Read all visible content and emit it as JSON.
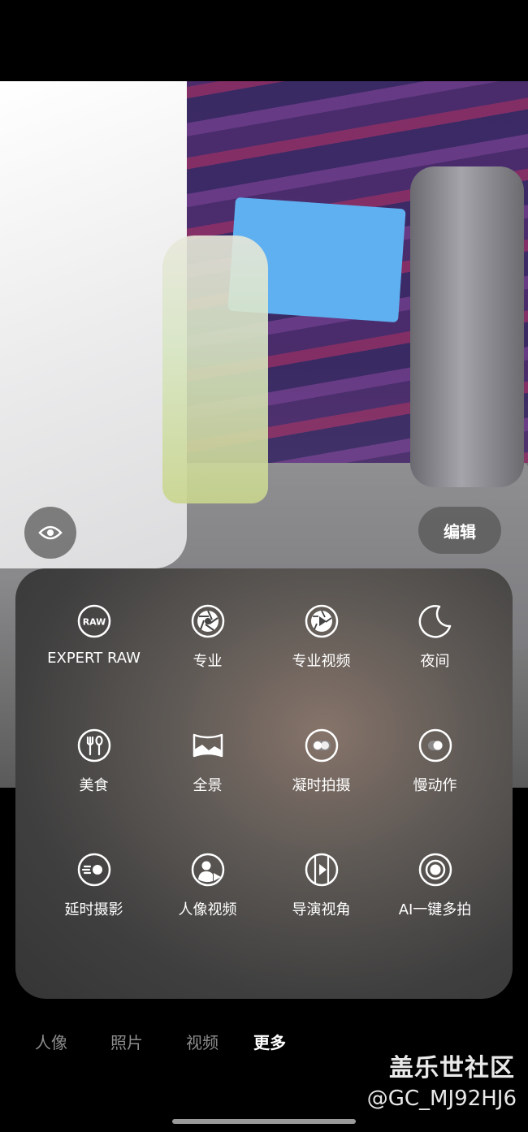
{
  "viewfinder": {
    "edit_label": "编辑"
  },
  "modes": [
    {
      "label": "EXPERT RAW",
      "icon": "raw-icon",
      "icon_text": "RAW"
    },
    {
      "label": "专业",
      "icon": "aperture-icon"
    },
    {
      "label": "专业视频",
      "icon": "pro-video-icon"
    },
    {
      "label": "夜间",
      "icon": "moon-icon"
    },
    {
      "label": "美食",
      "icon": "food-icon"
    },
    {
      "label": "全景",
      "icon": "panorama-icon"
    },
    {
      "label": "凝时拍摄",
      "icon": "hyperlapse-icon"
    },
    {
      "label": "慢动作",
      "icon": "slow-motion-icon"
    },
    {
      "label": "延时摄影",
      "icon": "timelapse-icon"
    },
    {
      "label": "人像视频",
      "icon": "portrait-video-icon"
    },
    {
      "label": "导演视角",
      "icon": "directors-view-icon"
    },
    {
      "label": "AI一键多拍",
      "icon": "single-take-icon"
    }
  ],
  "tabs": [
    {
      "label": "人像",
      "active": false
    },
    {
      "label": "照片",
      "active": false
    },
    {
      "label": "视频",
      "active": false
    },
    {
      "label": "更多",
      "active": true
    }
  ],
  "watermark": {
    "title": "盖乐世社区",
    "user": "@GC_MJ92HJ6"
  }
}
